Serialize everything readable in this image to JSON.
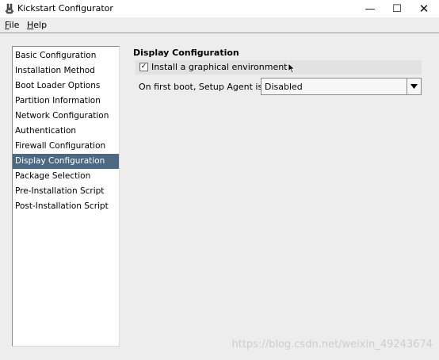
{
  "window": {
    "title": "Kickstart Configurator",
    "minimize_glyph": "—",
    "maximize_glyph": "☐",
    "close_glyph": "✕"
  },
  "menubar": {
    "file_mnemonic": "F",
    "file_rest": "ile",
    "help_mnemonic": "H",
    "help_rest": "elp"
  },
  "sidebar": {
    "items": [
      {
        "label": "Basic Configuration"
      },
      {
        "label": "Installation Method"
      },
      {
        "label": "Boot Loader Options"
      },
      {
        "label": "Partition Information"
      },
      {
        "label": "Network Configuration"
      },
      {
        "label": "Authentication"
      },
      {
        "label": "Firewall Configuration"
      },
      {
        "label": "Display Configuration"
      },
      {
        "label": "Package Selection"
      },
      {
        "label": "Pre-Installation Script"
      },
      {
        "label": "Post-Installation Script"
      }
    ],
    "selected_index": 7
  },
  "display": {
    "section_title": "Display Configuration",
    "graphical_label": "Install a graphical environment",
    "graphical_checked": true,
    "setup_agent_label": "On first boot, Setup Agent is:",
    "setup_agent_value": "Disabled"
  },
  "watermark": "https://blog.csdn.net/weixin_49243674",
  "colors": {
    "selection": "#4b6983",
    "background": "#ededed"
  }
}
